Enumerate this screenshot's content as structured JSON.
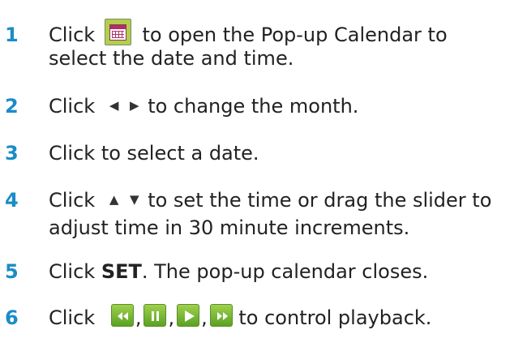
{
  "steps": [
    {
      "num": "1",
      "click": "Click",
      "text1": "to open the Pop-up Calendar to",
      "text2": "select the date and time."
    },
    {
      "num": "2",
      "click": "Click",
      "text1": "to change the month."
    },
    {
      "num": "3",
      "text1": "Click to select a date."
    },
    {
      "num": "4",
      "click": "Click",
      "text1": "to set the time or drag the slider to",
      "text2": "adjust time in 30 minute increments."
    },
    {
      "num": "5",
      "click": "Click",
      "bold": "SET",
      "text1": ". The pop-up calendar closes."
    },
    {
      "num": "6",
      "click": "Click",
      "sep": ",",
      "text1": "to control playback."
    }
  ],
  "icons": {
    "calendar": "calendar-icon",
    "month_prev": "◀",
    "month_next": "▶",
    "time_up": "▲",
    "time_down": "▼",
    "playback": [
      "rewind-icon",
      "pause-icon",
      "play-icon",
      "fast-forward-icon"
    ]
  },
  "colors": {
    "step_number": "#1a8cc7",
    "text": "#222222",
    "button_green": "#6bb02a"
  }
}
